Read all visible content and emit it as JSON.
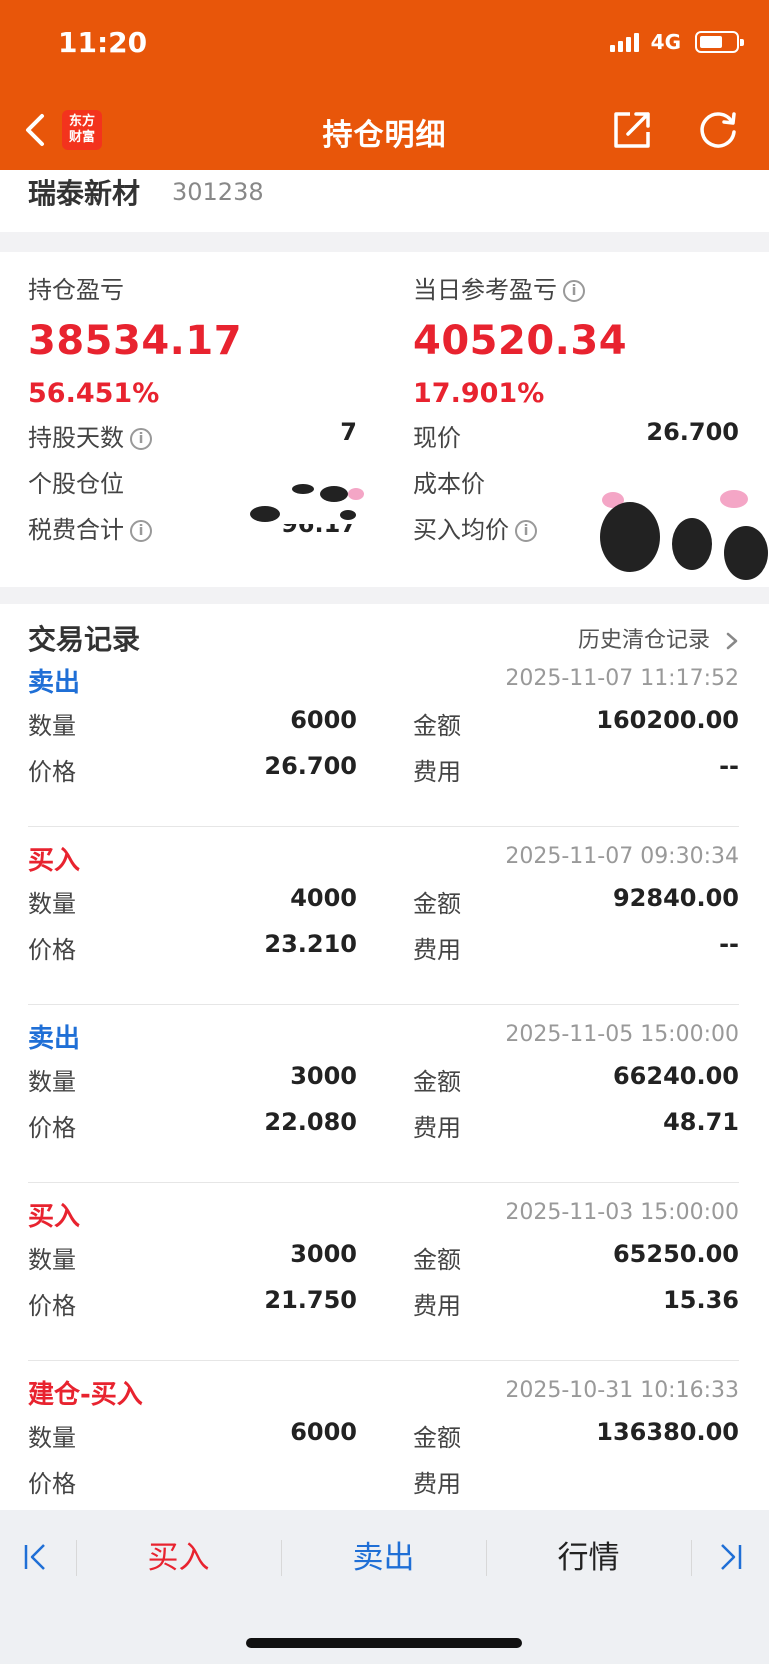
{
  "status_bar": {
    "time": "11:20",
    "network": "4G"
  },
  "header": {
    "title": "持仓明细",
    "logo_line1": "东方",
    "logo_line2": "财富"
  },
  "stock": {
    "name": "瑞泰新材",
    "code": "301238"
  },
  "summary": {
    "position_pl_label": "持仓盈亏",
    "position_pl_value": "38534.17",
    "position_pl_pct": "56.451%",
    "daily_pl_label": "当日参考盈亏",
    "daily_pl_value": "40520.34",
    "daily_pl_pct": "17.901%",
    "holding_days_label": "持股天数",
    "holding_days_value": "7",
    "position_ratio_label": "个股仓位",
    "tax_fee_label": "税费合计",
    "tax_fee_value": "96.17",
    "current_price_label": "现价",
    "current_price_value": "26.700",
    "cost_price_label": "成本价",
    "avg_buy_label": "买入均价",
    "info_glyph": "i"
  },
  "trades": {
    "title": "交易记录",
    "history_link": "历史清仓记录",
    "qty_label": "数量",
    "price_label": "价格",
    "amount_label": "金额",
    "fee_label": "费用",
    "records": [
      {
        "type": "卖出",
        "kind": "sell",
        "time": "2025-11-07 11:17:52",
        "qty": "6000",
        "price": "26.700",
        "amount": "160200.00",
        "fee": "--"
      },
      {
        "type": "买入",
        "kind": "buy",
        "time": "2025-11-07 09:30:34",
        "qty": "4000",
        "price": "23.210",
        "amount": "92840.00",
        "fee": "--"
      },
      {
        "type": "卖出",
        "kind": "sell",
        "time": "2025-11-05 15:00:00",
        "qty": "3000",
        "price": "22.080",
        "amount": "66240.00",
        "fee": "48.71"
      },
      {
        "type": "买入",
        "kind": "buy",
        "time": "2025-11-03 15:00:00",
        "qty": "3000",
        "price": "21.750",
        "amount": "65250.00",
        "fee": "15.36"
      },
      {
        "type": "建仓-买入",
        "kind": "buy",
        "time": "2025-10-31 10:16:33",
        "qty": "6000",
        "price": "",
        "amount": "136380.00",
        "fee": ""
      }
    ]
  },
  "bottom_bar": {
    "buy": "买入",
    "sell": "卖出",
    "quote": "行情"
  },
  "colors": {
    "header": "#E8560A",
    "profit": "#e8232f",
    "sell": "#1f6fd6"
  }
}
